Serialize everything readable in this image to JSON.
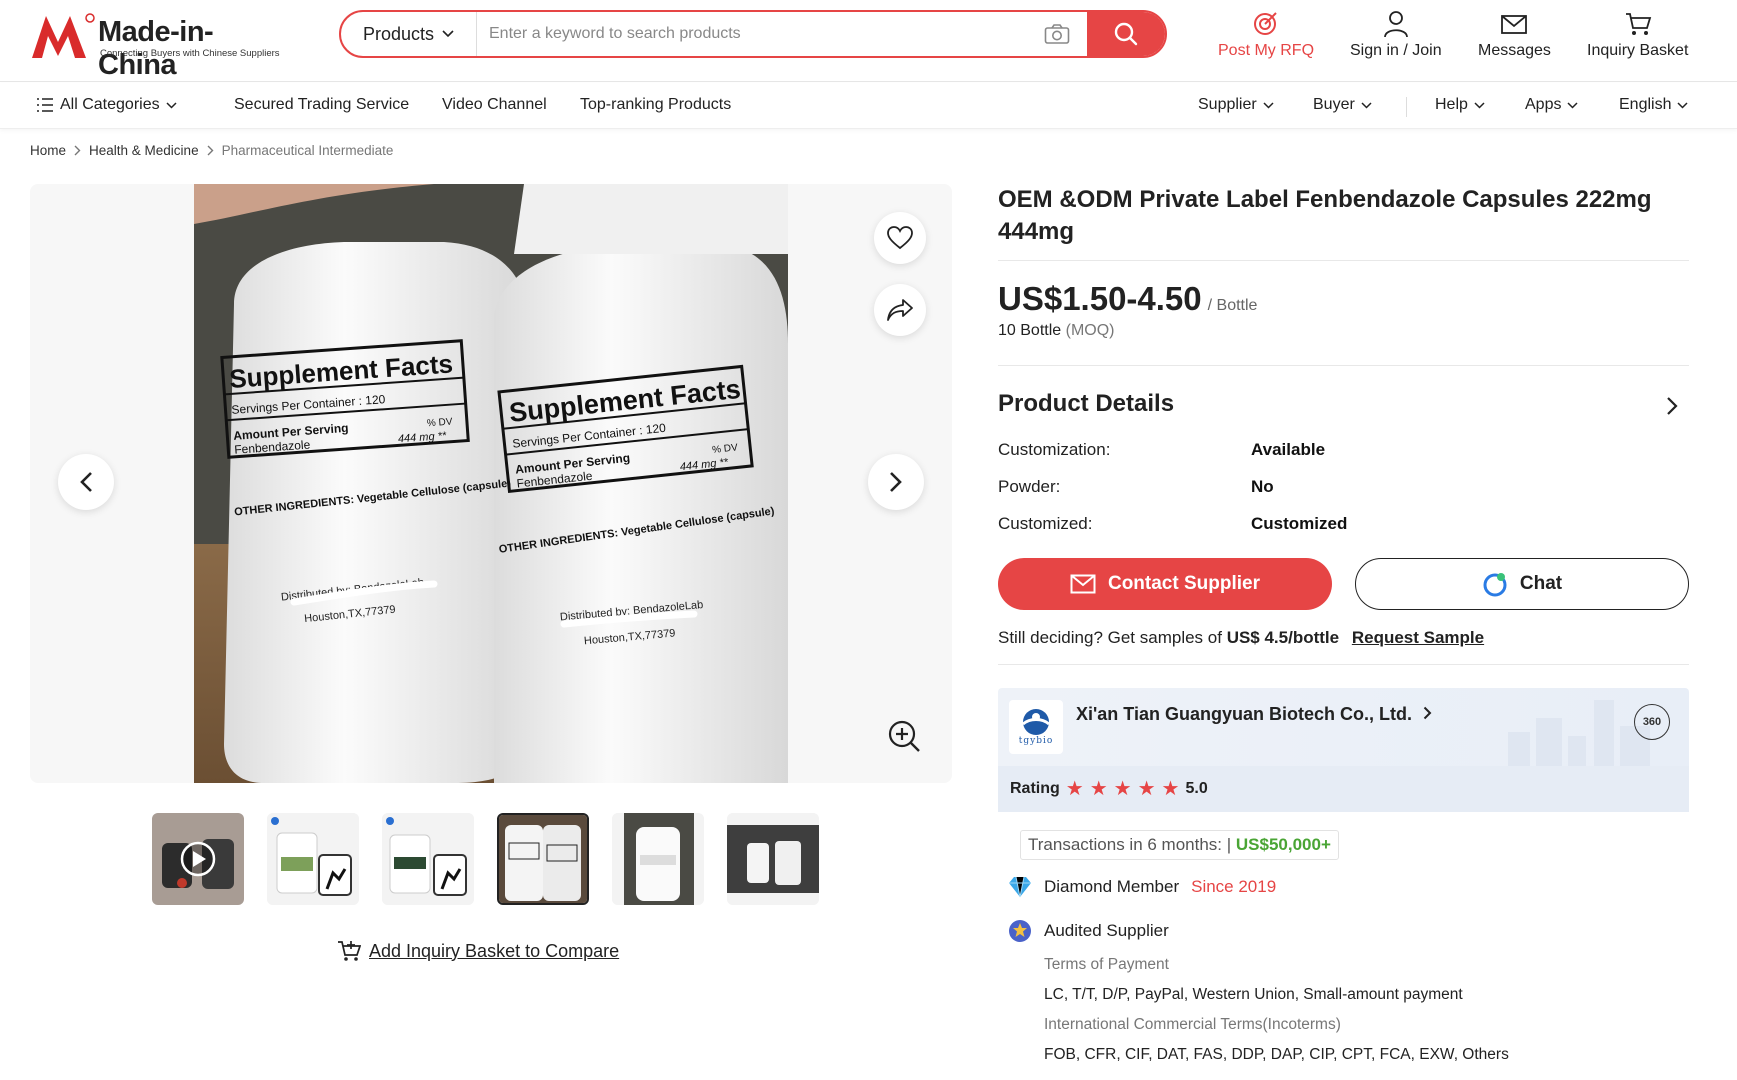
{
  "header": {
    "logo": {
      "brand": "Made-in-China",
      "tagline": "Connecting Buyers with Chinese Suppliers"
    },
    "search": {
      "category": "Products",
      "placeholder": "Enter a keyword to search products"
    },
    "actions": [
      {
        "label": "Post My RFQ",
        "icon": "rfq-target-icon"
      },
      {
        "label": "Sign in / Join",
        "icon": "user-icon"
      },
      {
        "label": "Messages",
        "icon": "envelope-icon"
      },
      {
        "label": "Inquiry Basket",
        "icon": "cart-icon"
      }
    ]
  },
  "nav": {
    "all_categories": "All Categories",
    "links": [
      "Secured Trading Service",
      "Video Channel",
      "Top-ranking Products"
    ],
    "right": [
      "Supplier",
      "Buyer",
      "Help",
      "Apps",
      "English"
    ]
  },
  "breadcrumb": [
    "Home",
    "Health & Medicine",
    "Pharmaceutical Intermediate"
  ],
  "gallery": {
    "thumbnail_count": 6,
    "active_thumbnail": 4,
    "compare_label": "Add Inquiry Basket to Compare",
    "photo_text": {
      "heading": "Supplement Facts",
      "servings": "Servings Per Container : 120",
      "amount": "Amount Per Serving",
      "dv": "% DV",
      "ingredient": "Fenbendazole",
      "dose": "444 mg **",
      "other": "OTHER INGREDIENTS: Vegetable Cellulose (capsule)",
      "distributed": "Distributed by: BendazoleLab",
      "city": "Houston,TX,77379"
    }
  },
  "product": {
    "title": "OEM &ODM Private Label Fenbendazole Capsules 222mg 444mg",
    "price": "US$1.50-4.50",
    "price_unit": "/ Bottle",
    "moq_value": "10 Bottle",
    "moq_label": "(MOQ)",
    "details_title": "Product Details",
    "details": [
      {
        "key": "Customization:",
        "value": "Available"
      },
      {
        "key": "Powder:",
        "value": "No"
      },
      {
        "key": "Customized:",
        "value": "Customized"
      }
    ],
    "contact_label": "Contact Supplier",
    "chat_label": "Chat",
    "sample_prefix": "Still deciding? Get samples of",
    "sample_price": "US$ 4.5/bottle",
    "sample_link": "Request Sample"
  },
  "supplier": {
    "logo_text": "tgybio",
    "name": "Xi'an Tian Guangyuan Biotech Co., Ltd.",
    "badge_360": "360",
    "rating_label": "Rating",
    "rating_value": "5.0",
    "stars": 5,
    "transactions_label": "Transactions in 6 months: |",
    "transactions_value": "US$50,000+",
    "member_label": "Diamond Member",
    "member_since": "Since 2019",
    "audited_label": "Audited Supplier",
    "payment_label": "Terms of Payment",
    "payment_value": "LC, T/T, D/P, PayPal, Western Union, Small-amount payment",
    "incoterms_label": "International Commercial Terms(Incoterms)",
    "incoterms_value": "FOB, CFR, CIF, DAT, FAS, DDP, DAP, CIP, CPT, FCA, EXW, Others"
  },
  "colors": {
    "brand_red": "#e64545",
    "text": "#222222",
    "success_green": "#4aa535",
    "muted": "#777777"
  }
}
